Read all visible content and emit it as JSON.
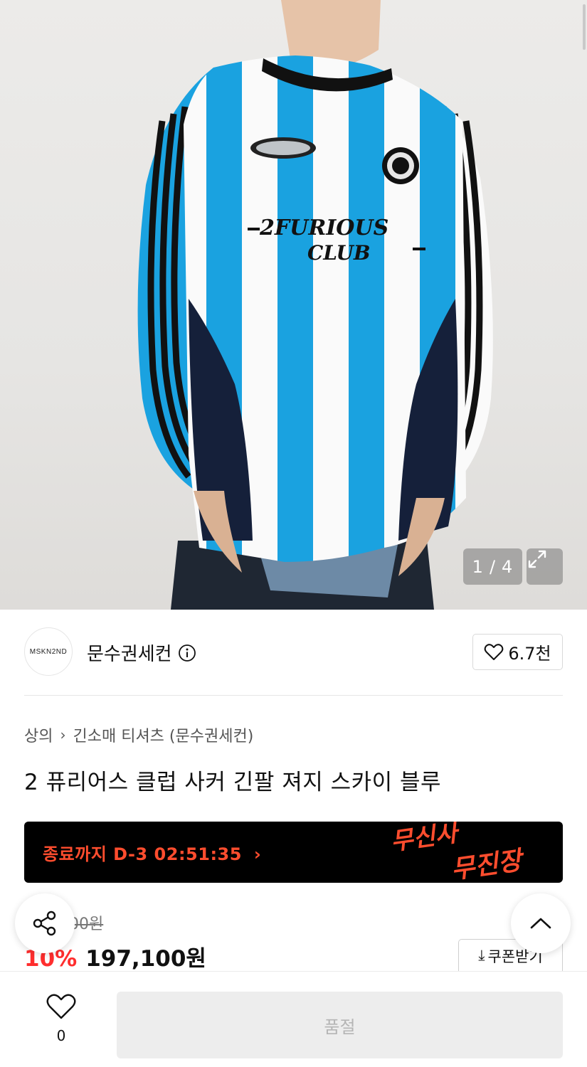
{
  "gallery": {
    "current": "1",
    "separator": "/",
    "total": "4",
    "expand_icon": "expand-icon"
  },
  "brand": {
    "logo_text": "MSKN2ND",
    "name": "문수권세컨",
    "info_icon": "info-icon",
    "likes": "6.7천"
  },
  "breadcrumb": {
    "category": "상의",
    "subcategory": "긴소매 티셔츠 (문수권세컨)"
  },
  "product": {
    "title": "2 퓨리어스 클럽 사커 긴팔 져지 스카이 블루"
  },
  "banner": {
    "countdown": "종료까지 D-3 02:51:35",
    "logo_line1": "무신사",
    "logo_line2": "무진장",
    "accent": "#ff4d2e"
  },
  "price": {
    "original": "219,000원",
    "discount": "10%",
    "final": "197,100원",
    "coupon_label": "쿠폰받기"
  },
  "bottom_bar": {
    "wish_count": "0",
    "action_label": "품절"
  },
  "colors": {
    "sale_red": "#ff2e2e",
    "banner_bg": "#000000",
    "disabled_bg": "#ededed"
  }
}
